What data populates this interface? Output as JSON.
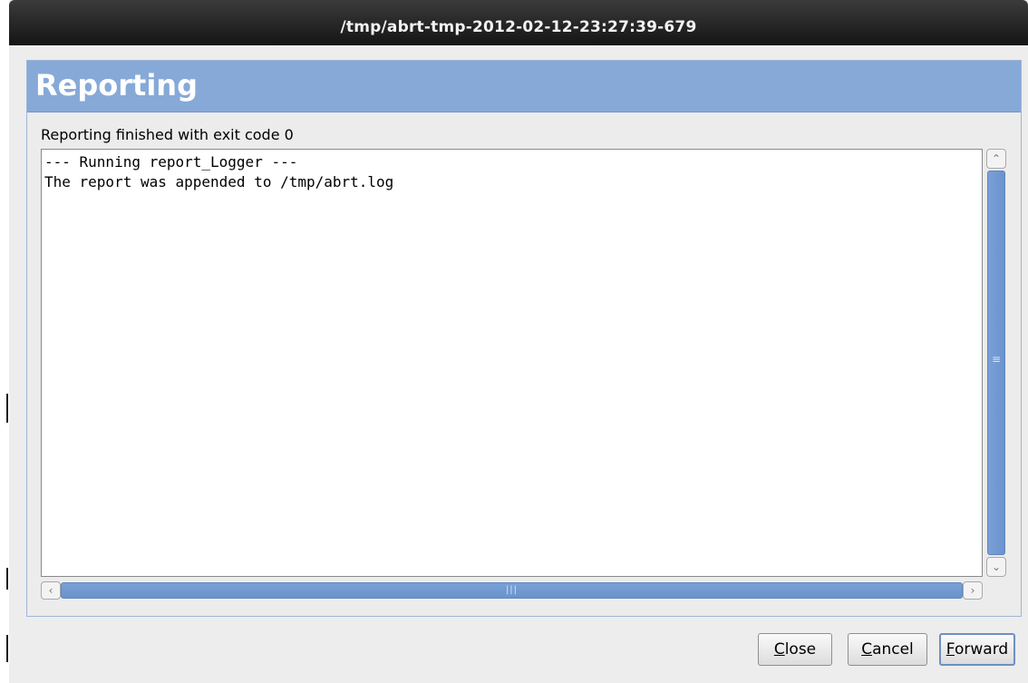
{
  "window": {
    "title": "/tmp/abrt-tmp-2012-02-12-23:27:39-679"
  },
  "page": {
    "heading": "Reporting",
    "status": "Reporting finished with exit code 0"
  },
  "log": {
    "lines": [
      "--- Running report_Logger ---",
      "The report was appended to /tmp/abrt.log"
    ]
  },
  "scrollbars": {
    "up_icon": "chevron-up-icon",
    "down_icon": "chevron-down-icon",
    "left_icon": "chevron-left-icon",
    "right_icon": "chevron-right-icon"
  },
  "buttons": {
    "close": {
      "mnemonic": "C",
      "rest": "lose"
    },
    "cancel": {
      "mnemonic": "C",
      "rest": "ancel"
    },
    "forward": {
      "mnemonic": "F",
      "rest": "orward"
    }
  },
  "colors": {
    "header_bg": "#86a9d8",
    "scroll_thumb": "#7aa0d6",
    "titlebar": "#1e1e1e"
  }
}
